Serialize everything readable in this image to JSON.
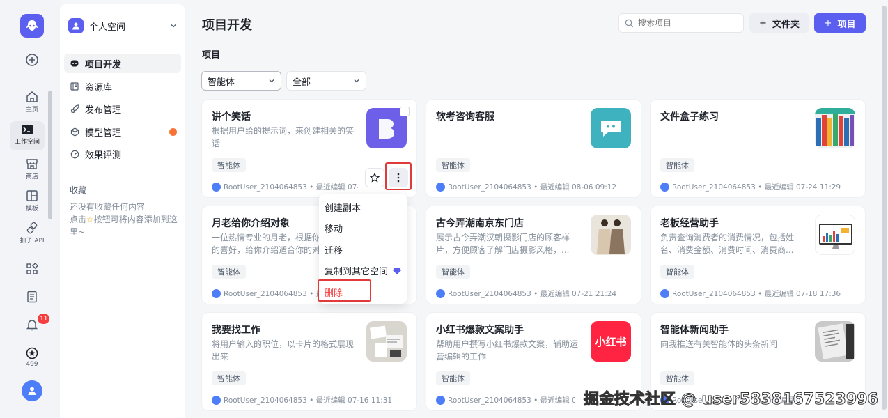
{
  "rail": {
    "items": [
      {
        "label": "主页",
        "icon": "home-icon"
      },
      {
        "label": "工作空间",
        "icon": "workspace-icon"
      },
      {
        "label": "商店",
        "icon": "store-icon"
      },
      {
        "label": "模板",
        "icon": "template-icon"
      },
      {
        "label": "扣子 API",
        "icon": "api-icon"
      }
    ],
    "notif_count": "11",
    "points": "499"
  },
  "sidebar": {
    "space_name": "个人空间",
    "nav": [
      {
        "label": "项目开发",
        "icon": "bot-icon"
      },
      {
        "label": "资源库",
        "icon": "library-icon"
      },
      {
        "label": "发布管理",
        "icon": "rocket-icon"
      },
      {
        "label": "模型管理",
        "icon": "cube-icon"
      },
      {
        "label": "效果评测",
        "icon": "gauge-icon"
      }
    ],
    "favorites_title": "收藏",
    "favorites_empty": [
      "还没有收藏任何内容",
      "点击",
      "按钮可将内容添加到这里~"
    ]
  },
  "header": {
    "title": "项目开发",
    "search_placeholder": "搜索项目",
    "folder_button": "文件夹",
    "project_button": "项目"
  },
  "section_title": "项目",
  "filters": {
    "type": "智能体",
    "scope": "全部"
  },
  "cards": [
    {
      "title": "讲个笑话",
      "desc": "根据用户给的提示词，来创建相关的笑话",
      "tag": "智能体",
      "meta": "RootUser_2104064853 • 最近编辑 07-..."
    },
    {
      "title": "软考咨询客服",
      "desc": "",
      "tag": "智能体",
      "meta": "RootUser_2104064853 • 最近编辑 08-06 09:12"
    },
    {
      "title": "文件盒子练习",
      "desc": "",
      "tag": "智能体",
      "meta": "RootUser_2104064853 • 最近编辑 07-24 11:29"
    },
    {
      "title": "月老给你介绍对象",
      "desc": "一位热情专业的月老，根据你的喜好，给你介绍适合你的对象，助...",
      "tag": "智能体",
      "meta": "RootUser_2104064853 • 最近编辑 07-..."
    },
    {
      "title": "古今弄潮南京东门店",
      "desc": "展示古今弄潮汉朝摄影门店的顾客样片，方便顾客了解门店摄影风格，...",
      "tag": "智能体",
      "meta": "RootUser_2104064853 • 最近编辑 07-21 21:24"
    },
    {
      "title": "老板经营助手",
      "desc": "负责查询消费者的消费情况，包括姓名、消费金额、消费时间、消费商...",
      "tag": "智能体",
      "meta": "RootUser_2104064853 • 最近编辑 07-18 17:36"
    },
    {
      "title": "我要找工作",
      "desc": "将用户输入的职位，以卡片的格式展现出来",
      "tag": "智能体",
      "meta": "RootUser_2104064853 • 最近编辑 07-16 11:31"
    },
    {
      "title": "小红书爆款文案助手",
      "desc": "帮助用户撰写小红书爆款文案，辅助运营编辑的工作",
      "tag": "智能体",
      "meta": "RootUser_2104064853 • 最近编辑 07-..."
    },
    {
      "title": "智能体新闻助手",
      "desc": "向我推送有关智能体的头条新闻",
      "tag": "智能体",
      "meta": "RootUser_2104064853 • 最近编辑 07-..."
    }
  ],
  "xhs_logo_text": "小红书",
  "context_menu": [
    "创建副本",
    "移动",
    "迁移",
    "复制到其它空间",
    "删除"
  ],
  "watermark": "掘金技术社区 @ user5838167523996",
  "colors": {
    "accent": "#5b5ff0",
    "danger": "#f53f3f",
    "highlight": "#e03a3a"
  }
}
